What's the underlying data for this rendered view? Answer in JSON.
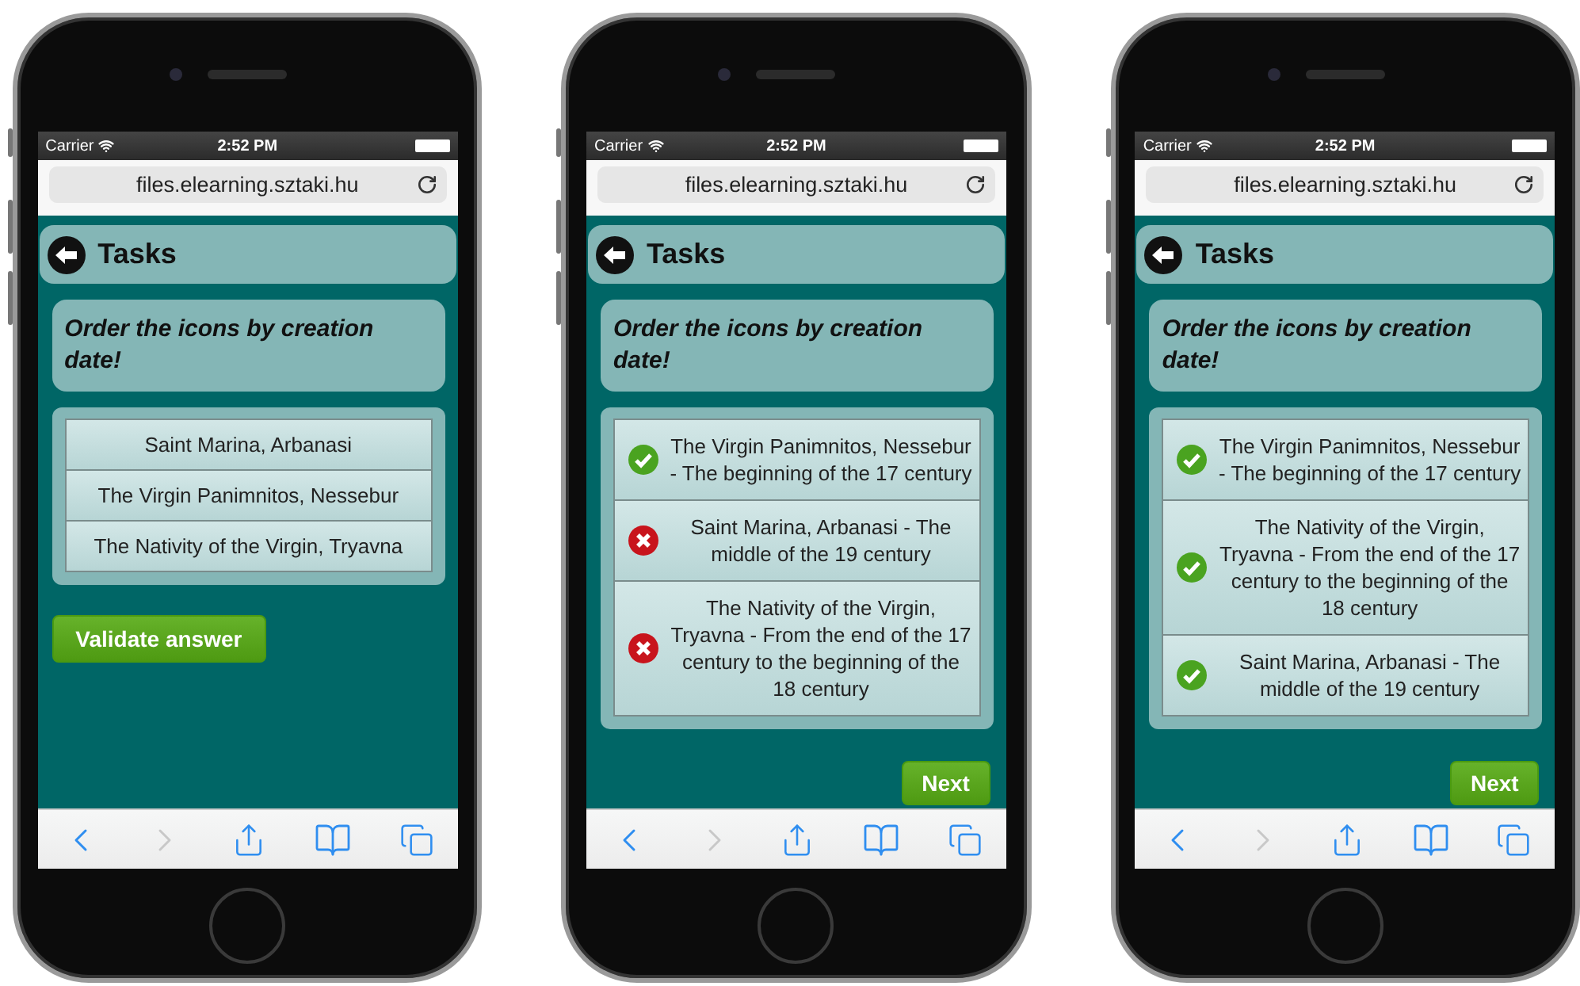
{
  "phones": [
    {
      "status": {
        "carrier": "Carrier",
        "time": "2:52 PM"
      },
      "url": "files.elearning.sztaki.hu",
      "header": {
        "title": "Tasks"
      },
      "question": "Order the icons by creation date!",
      "answers": [
        {
          "text": "Saint Marina, Arbanasi",
          "kind": "plain"
        },
        {
          "text": "The Virgin Panimnitos, Nessebur",
          "kind": "plain"
        },
        {
          "text": "The Nativity of the Virgin, Tryavna",
          "kind": "plain"
        }
      ],
      "button": {
        "label": "Validate answer",
        "kind": "validate"
      },
      "toolbar": {
        "back_disabled": false,
        "forward_disabled": true
      }
    },
    {
      "status": {
        "carrier": "Carrier",
        "time": "2:52 PM"
      },
      "url": "files.elearning.sztaki.hu",
      "header": {
        "title": "Tasks"
      },
      "question": "Order the icons by creation date!",
      "answers": [
        {
          "text": "The Virgin Panimnitos, Nessebur - The beginning of the 17 century",
          "kind": "correct"
        },
        {
          "text": "Saint Marina, Arbanasi - The middle of the 19 century",
          "kind": "wrong"
        },
        {
          "text": "The Nativity of the Virgin, Tryavna - From the end of the 17 century to the beginning of the 18 century",
          "kind": "wrong"
        }
      ],
      "button": {
        "label": "Next",
        "kind": "next"
      },
      "toolbar": {
        "back_disabled": false,
        "forward_disabled": true
      }
    },
    {
      "status": {
        "carrier": "Carrier",
        "time": "2:52 PM"
      },
      "url": "files.elearning.sztaki.hu",
      "header": {
        "title": "Tasks"
      },
      "question": "Order the icons by creation date!",
      "answers": [
        {
          "text": "The Virgin Panimnitos, Nessebur - The beginning of the 17 century",
          "kind": "correct"
        },
        {
          "text": "The Nativity of the Virgin, Tryavna - From the end of the 17 century to the beginning of the 18 century",
          "kind": "correct"
        },
        {
          "text": "Saint Marina, Arbanasi - The middle of the 19 century",
          "kind": "correct"
        }
      ],
      "button": {
        "label": "Next",
        "kind": "next"
      },
      "toolbar": {
        "back_disabled": false,
        "forward_disabled": true
      }
    }
  ]
}
